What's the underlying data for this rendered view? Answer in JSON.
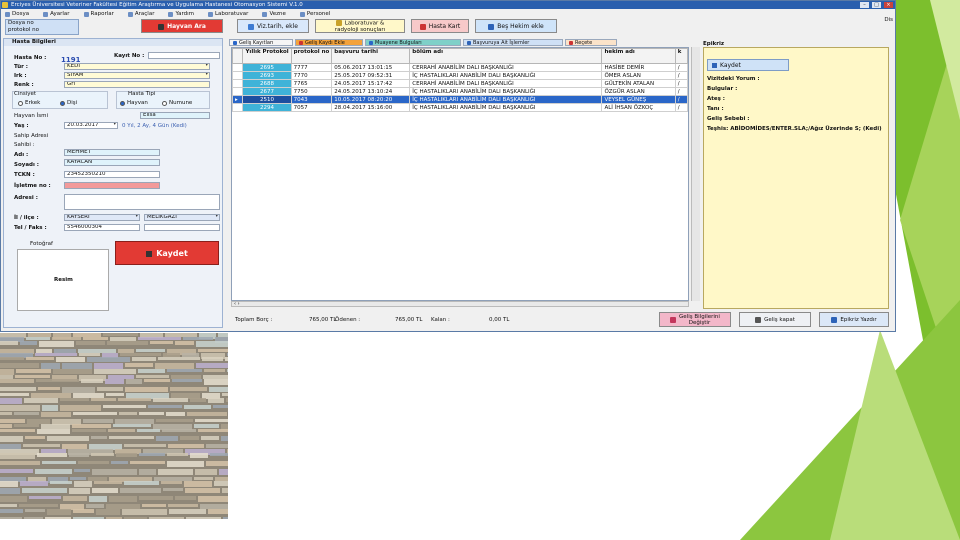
{
  "window": {
    "title": "Erciyes Üniversitesi Veteriner Fakültesi Eğitim Araştırma ve Uygulama Hastanesi Otomasyon Sistemi V.1.0",
    "extra": "Dis"
  },
  "menu": [
    "Dosya",
    "Ayarlar",
    "Raporlar",
    "Araçlar",
    "Yardım",
    "Laboratuvar",
    "Vezne",
    "Personel"
  ],
  "toolbar": {
    "dosya_label_1": "Dosya no",
    "dosya_label_2": "protokol no",
    "hayvan_ara": "Hayvan Ara",
    "viz_tarih": "Viz.tarih, ekle",
    "lab_1": "Laboratuvar &",
    "lab_2": "radyoloji sonuçları",
    "kart": "Hasta Kart",
    "kel": "Beş Hekim ekle"
  },
  "form": {
    "header": "Hasta Bilgileri",
    "hasta_no_label": "Hasta No :",
    "hasta_no": "1191",
    "kayit_label": "Kayıt No :",
    "tur_label": "Tür :",
    "tur": "KEDİ",
    "irk_label": "Irk :",
    "irk": "SİYAM",
    "renk_label": "Renk :",
    "renk": "Gri",
    "cinsiyet_label": "Cinsiyet",
    "erkek": "Erkek",
    "disi": "Dişi",
    "hasta_tipi_label": "Hasta Tipi",
    "hayvan": "Hayvan",
    "numune": "Numune",
    "hayvan_ismi_label": "Hayvan İsmi",
    "hayvan_ismi": "Elisa",
    "yas_label": "Yaş :",
    "yas": "20.03.2017",
    "yas_calc": "0 Yıl, 2 Ay, 4 Gün (Kedi)",
    "sahip_label": "Sahip Adresi",
    "sahibi_label": "Sahibi :",
    "adi_label": "Adı :",
    "adi": "MEHMET",
    "soyadi_label": "Soyadı :",
    "soyadi": "KAYACAN",
    "tckn_label": "TCKN :",
    "tckn": "23452350210",
    "isletme_label": "İşletme no :",
    "adres_label": "Adresi :",
    "il_label": "İl / ilçe :",
    "il": "KAYSERİ",
    "ilce": "MELİKGAZİ",
    "tel_label": "Tel / Faks :",
    "tel": "5546000304",
    "fotograf_label": "Fotoğraf",
    "resim": "Resim",
    "kaydet": "Kaydet"
  },
  "tabs": [
    "Geliş Kayıtları",
    "Geliş Kaydı Ekle",
    "Muayene Bulguları",
    "Başvuruya Ait İşlemler",
    "Reçete"
  ],
  "table": {
    "headers": [
      "Yıllık Protokol",
      "protokol no",
      "başvuru tarihi",
      "bölüm adı",
      "hekim adı",
      "k"
    ],
    "rows": [
      [
        "2695",
        "7777",
        "05.06.2017 13:01:15",
        "CERRAHİ ANABİLİM DALI BAŞKANLIĞI",
        "HASİBE DEMİR",
        "/"
      ],
      [
        "2693",
        "7770",
        "25.05.2017 09:52:31",
        "İÇ HASTALIKLARI ANABİLİM DALI BAŞKANLIĞI",
        "ÖMER ASLAN",
        "/"
      ],
      [
        "2688",
        "7765",
        "24.05.2017 15:17:42",
        "CERRAHİ ANABİLİM DALI BAŞKANLIĞI",
        "GÜLTEKİN ATALAN",
        "/"
      ],
      [
        "2677",
        "7750",
        "24.05.2017 13:10:24",
        "İÇ HASTALIKLARI ANABİLİM DALI BAŞKANLIĞI",
        "ÖZGÜR ASLAN",
        "/"
      ],
      [
        "2510",
        "7043",
        "10.05.2017 08:20:20",
        "İÇ HASTALIKLARI ANABİLİM DALI BAŞKANLIĞI",
        "VEYSEL GÜNEŞ",
        "/"
      ],
      [
        "2294",
        "7057",
        "28.04.2017 15:16:00",
        "İÇ HASTALIKLARI ANABİLİM DALI BAŞKANLIĞI",
        "ALİ İHSAN ÖZKOÇ",
        "/"
      ]
    ],
    "selected_row": 4
  },
  "right": {
    "header": "Epikriz",
    "kaydet": "Kaydet",
    "lines": [
      "Vizitdeki Yorum :",
      "Bulgular :",
      "Ateş :",
      "Tanı :",
      "Geliş Sebebi :",
      "Teşhis: ABİDOMİDES/ENTER.SLA;/Ağız Üzerinde S; (Kedi)"
    ]
  },
  "status": {
    "toplam_label": "Toplam Borç :",
    "toplam": "765,00 TL",
    "odenen_label": "Ödenen :",
    "odenen": "765,00 TL",
    "kalan_label": "Kalan :",
    "kalan": "0,00 TL",
    "gelis_btn_1": "Geliş Bilgilerini",
    "gelis_btn_2": "Değiştir",
    "gelis_kapat": "Geliş kapat",
    "epikriz_yazdir": "Epikriz Yazdır"
  },
  "colors": {
    "accent_red": "#e23a34",
    "accent_blue": "#2a66c8",
    "slide_green": "#8cc63f"
  }
}
